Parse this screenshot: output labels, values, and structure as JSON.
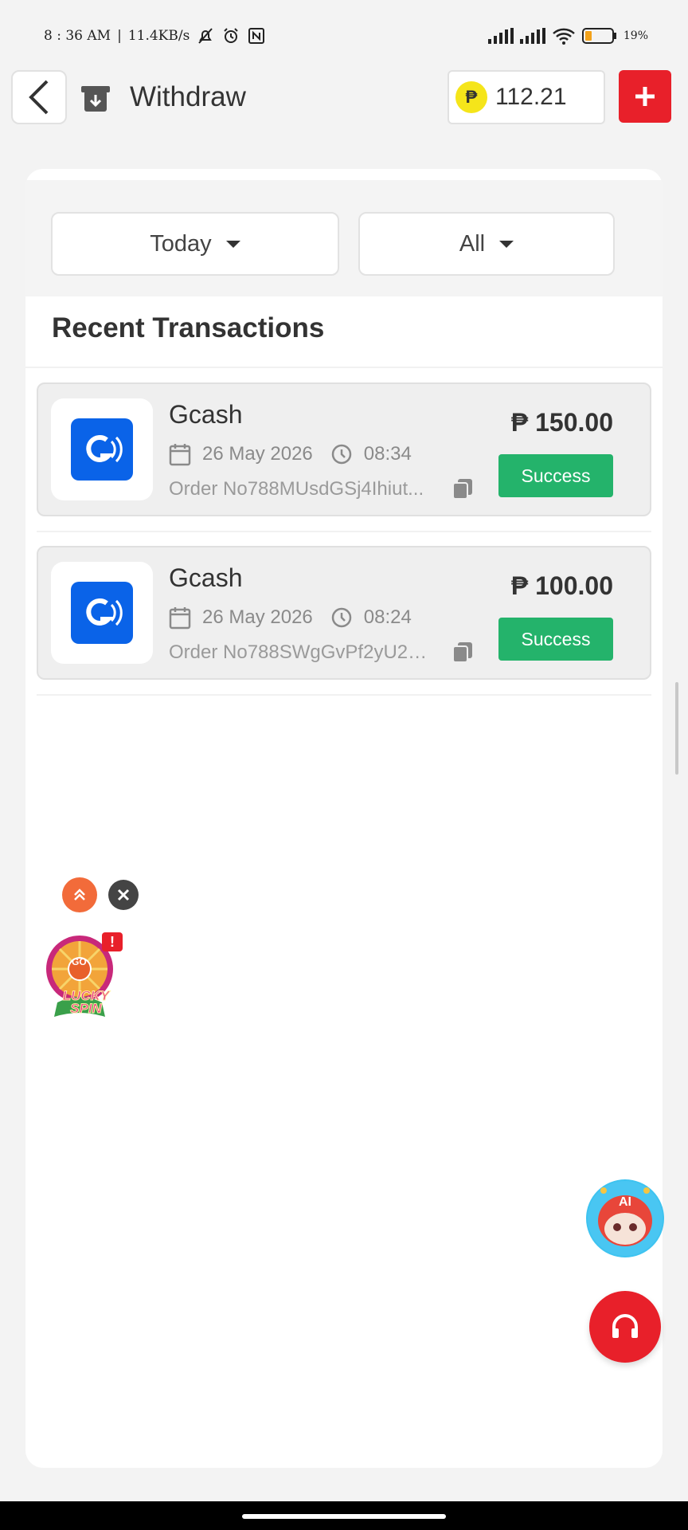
{
  "status_bar": {
    "time": "8 : 36 AM",
    "network_speed": "11.4KB/s",
    "battery": "19",
    "battery_unit": "%"
  },
  "header": {
    "title": "Withdraw",
    "balance": "112.21",
    "currency_symbol": "₱"
  },
  "filters": {
    "date": "Today",
    "status": "All"
  },
  "section_title": "Recent Transactions",
  "transactions": [
    {
      "method": "Gcash",
      "date": "26 May 2026",
      "time": "08:34",
      "order": "Order No788MUsdGSj4Ihiut...",
      "amount": "₱ 150.00",
      "status": "Success"
    },
    {
      "method": "Gcash",
      "date": "26 May 2026",
      "time": "08:24",
      "order": "Order No788SWgGvPf2yU2L...",
      "amount": "₱ 100.00",
      "status": "Success"
    }
  ],
  "widgets": {
    "lucky_spin_go": "GO",
    "lucky_spin_label": "LUCKY SPIN",
    "lucky_spin_badge": "!",
    "ai_label": "AI"
  },
  "colors": {
    "accent_red": "#e8202a",
    "success_green": "#24b36b",
    "gcash_blue": "#0a63e8",
    "coin_yellow": "#f5e51a"
  }
}
